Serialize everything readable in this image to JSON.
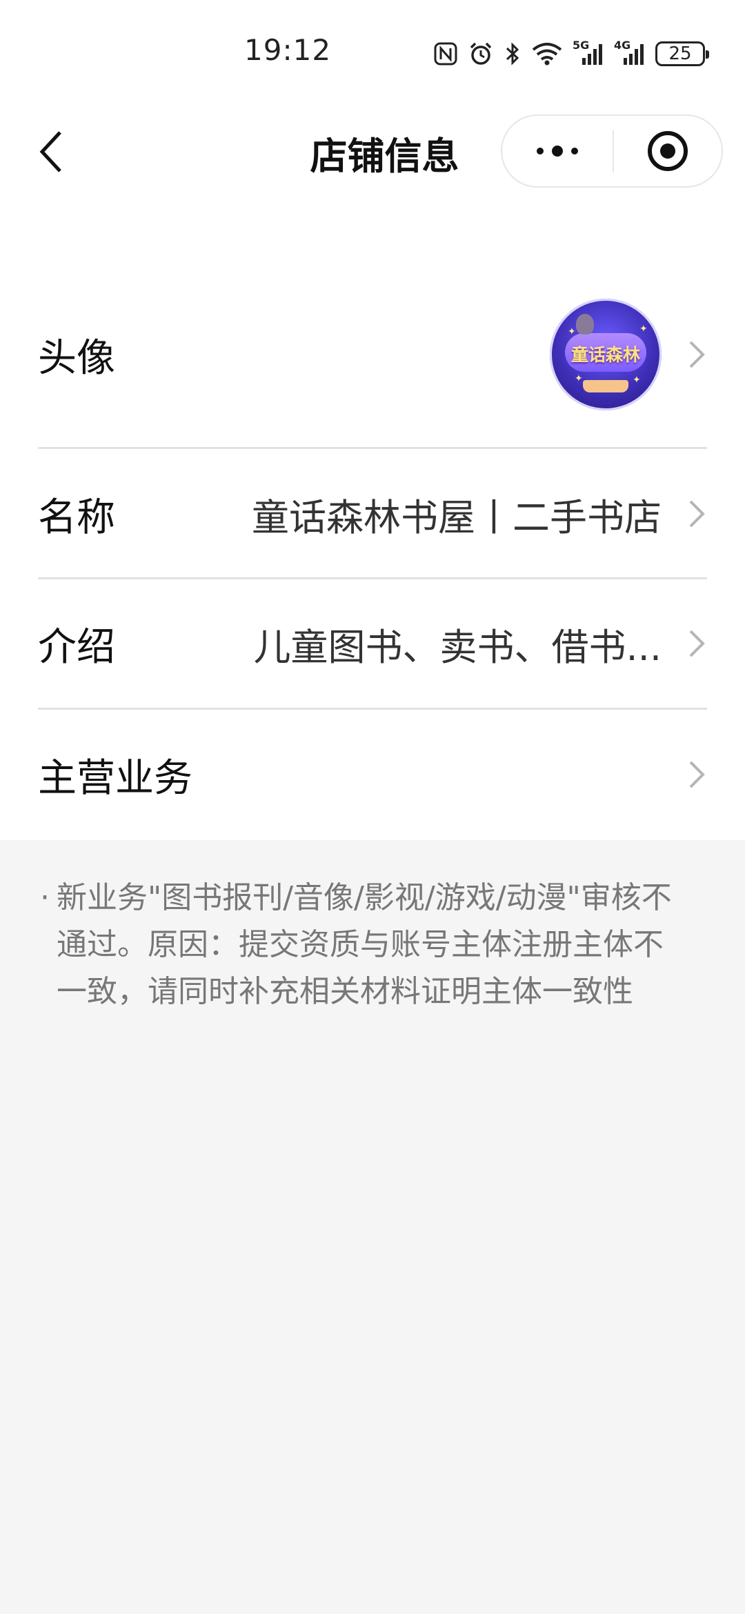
{
  "status_bar": {
    "time": "19:12",
    "network_5g": "5G",
    "network_4g": "4G",
    "battery": "25",
    "icons": [
      "nfc-icon",
      "alarm-icon",
      "bluetooth-icon",
      "wifi-icon",
      "signal-5g-icon",
      "signal-4g-icon",
      "battery-icon"
    ]
  },
  "nav": {
    "title": "店铺信息",
    "back_icon": "back-chevron-icon",
    "more_icon": "more-dots-icon",
    "close_icon": "target-circle-icon"
  },
  "rows": {
    "avatar": {
      "label": "头像",
      "image_text": "童话森林"
    },
    "name": {
      "label": "名称",
      "value": "童话森林书屋丨二手书店"
    },
    "intro": {
      "label": "介绍",
      "value": "儿童图书、卖书、借书..."
    },
    "business": {
      "label": "主营业务",
      "value": ""
    }
  },
  "notice": {
    "bullet": "·",
    "text": "新业务\"图书报刊/音像/影视/游戏/动漫\"审核不通过。原因：提交资质与账号主体注册主体不一致，请同时补充相关材料证明主体一致性"
  },
  "colors": {
    "page_background": "#f5f5f5",
    "card_background": "#ffffff",
    "divider": "#e2e2e2",
    "notice_text": "#777777",
    "chevron": "#b5b5b5"
  }
}
